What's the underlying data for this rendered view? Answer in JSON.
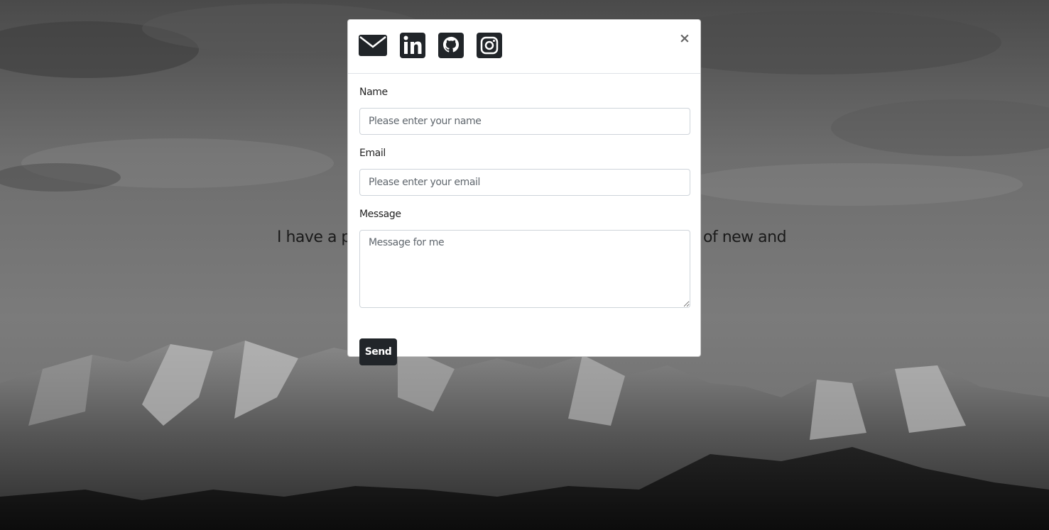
{
  "hero": {
    "text_left": "I have a pas",
    "text_right": "of new and"
  },
  "contact_modal": {
    "social_icons": [
      {
        "name": "envelope-icon"
      },
      {
        "name": "linkedin-icon"
      },
      {
        "name": "github-icon"
      },
      {
        "name": "instagram-icon"
      }
    ],
    "close_label": "×",
    "name_label": "Name",
    "name_placeholder": "Please enter your name",
    "email_label": "Email",
    "email_placeholder": "Please enter your email",
    "message_label": "Message",
    "message_placeholder": "Message for me",
    "send_label": "Send"
  },
  "colors": {
    "send_button_bg": "#212529",
    "icon_color": "#212529"
  }
}
